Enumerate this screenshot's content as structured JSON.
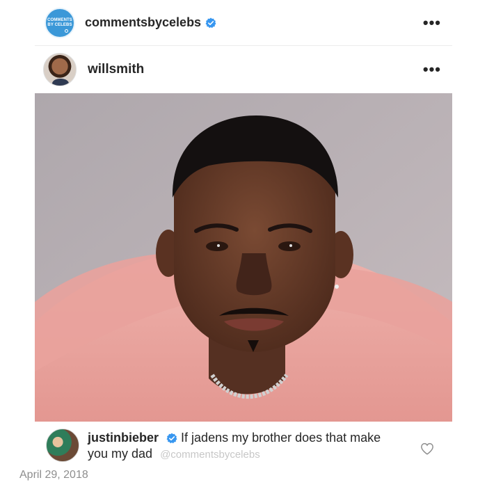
{
  "outer_post": {
    "avatar_logo_line1": "COMMENTS",
    "avatar_logo_line2": "BY CELEBS",
    "username": "commentsbycelebs",
    "verified": true,
    "more_icon": "ellipsis-icon",
    "more_label": "•••"
  },
  "inner_post": {
    "username": "willsmith",
    "more_icon": "ellipsis-icon",
    "more_label": "•••"
  },
  "photo": {
    "subject": "portrait-photo",
    "colors": {
      "background": "#b8b0b4",
      "shirt": "#e9a3a0",
      "skin": "#6b3f2a",
      "hair": "#141010",
      "chain": "#c9c9c9"
    }
  },
  "comment": {
    "username": "justinbieber",
    "verified": true,
    "text": "If jadens my brother does that make you my dad",
    "watermark": "@commentsbycelebs",
    "like_icon": "heart-outline-icon"
  },
  "date": "April 29, 2018",
  "colors": {
    "verified_blue": "#3897f0",
    "text": "#262626",
    "muted": "#8e8e8e",
    "brand_blue": "#3b98d8"
  }
}
